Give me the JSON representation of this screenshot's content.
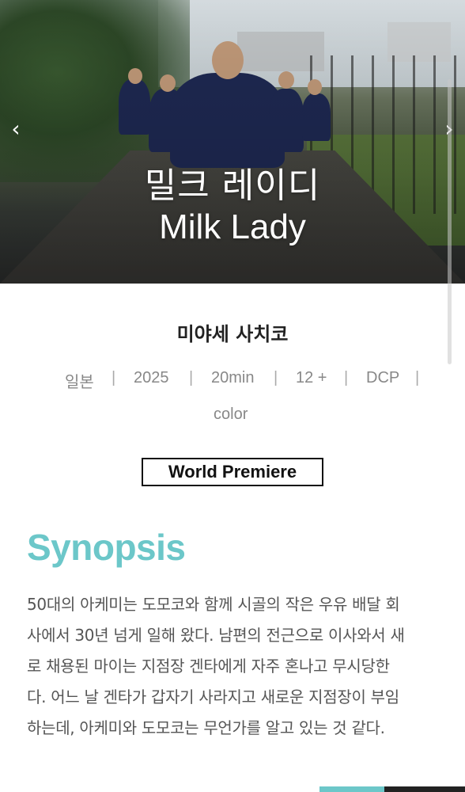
{
  "hero": {
    "title_ko": "밀크 레이디",
    "title_en": "Milk Lady",
    "prev_arrow": "‹",
    "next_arrow": "›",
    "icons": {
      "prev": "chevron-left-icon",
      "next": "chevron-right-icon"
    }
  },
  "director": "미야세 사치코",
  "meta": {
    "items": [
      "일본",
      "2025",
      "20min",
      "12 +",
      "DCP",
      "color"
    ],
    "separator": "|"
  },
  "badge": {
    "label": "World Premiere"
  },
  "synopsis": {
    "heading": "Synopsis",
    "lines": [
      "50대의 아케미는 도모코와 함께 시골의 작은 우유 배달 회",
      "사에서 30년 넘게 일해 왔다. 남편의 전근으로 이사와서 새",
      "로 채용된 마이는 지점장 겐타에게 자주 혼나고 무시당한",
      "다. 어느 날 겐타가 갑자기 사라지고 새로운 지점장이 부임",
      "하는데, 아케미와 도모코는 무언가를 알고 있는 것 같다."
    ]
  },
  "colors": {
    "accent": "#6cc7c9",
    "dark": "#222222",
    "meta_gray": "#888888"
  }
}
